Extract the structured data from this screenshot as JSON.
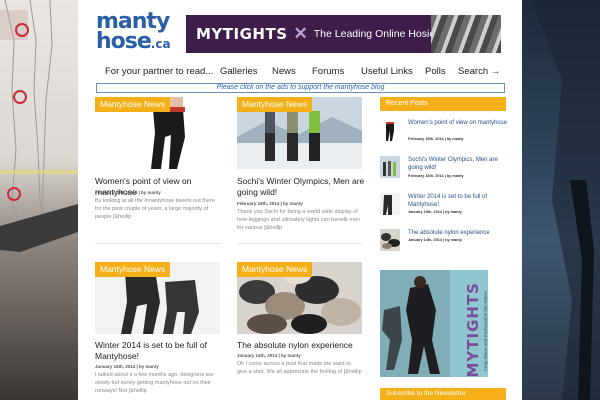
{
  "logo": {
    "line1": "manty",
    "line2": "hose",
    "tld": ".ca",
    "icon": "mantyhose-logo"
  },
  "banner": {
    "brand": "MYTIGHTS",
    "icon": "x-mark-icon",
    "tagline": "The Leading Online Hosiery Store"
  },
  "nav": {
    "items": [
      "For your partner to read...",
      "Galleries",
      "News",
      "Forums",
      "Useful Links",
      "Polls"
    ],
    "search": "Search →"
  },
  "notice": "Please click on the ads to support the mantyhose blog",
  "accent_color": "#f5b019",
  "posts": [
    {
      "tag": "Mantyhose News",
      "title": "Women's point of view on mantyhose",
      "meta": "February 19th, 2014 | by manty",
      "excerpt": "By looking at all the #mantyhose tweets out there for the past couple of years, a large majority of people [&hellip"
    },
    {
      "tag": "Mantyhose News",
      "title": "Sochi's Winter Olympics, Men are going wild!",
      "meta": "February 16th, 2014 | by manty",
      "excerpt": "Thank you Sochi for being a world wide display of how leggings and ultimately tights can benefit men for various [&hellip"
    },
    {
      "tag": "Mantyhose News",
      "title": "Winter 2014 is set to be full of Mantyhose!",
      "meta": "January 15th, 2014 | by manty",
      "excerpt": "I talked about it a few months ago, designers are slowly but surely getting mantyhose out on their runways! Not [&hellip"
    },
    {
      "tag": "Mantyhose News",
      "title": "The absolute nylon experience",
      "meta": "January 14th, 2014 | by manty",
      "excerpt": "Ok I come across a post that made me want to give a shot. We all appreciate the feeling of [&hellip"
    }
  ],
  "sidebar": {
    "recent_label": "Recent Posts",
    "items": [
      {
        "title": "Women's point of view on mantyhose",
        "meta": "February 19th, 2014 | by manty"
      },
      {
        "title": "Sochi's Winter Olympics, Men are going wild!",
        "meta": "February 16th, 2014 | by manty"
      },
      {
        "title": "Winter 2014 is set to be full of Mantyhose!",
        "meta": "January 15th, 2014 | by manty"
      },
      {
        "title": "The absolute nylon experience",
        "meta": "January 14th, 2014 | by manty"
      }
    ],
    "ad": {
      "brand": "MYTIGHTS",
      "icon": "x-mark-icon",
      "tagline": "Keep Warm and Fashionable this Winter"
    },
    "newsletter_label": "Subscribe to the Newsletter"
  }
}
